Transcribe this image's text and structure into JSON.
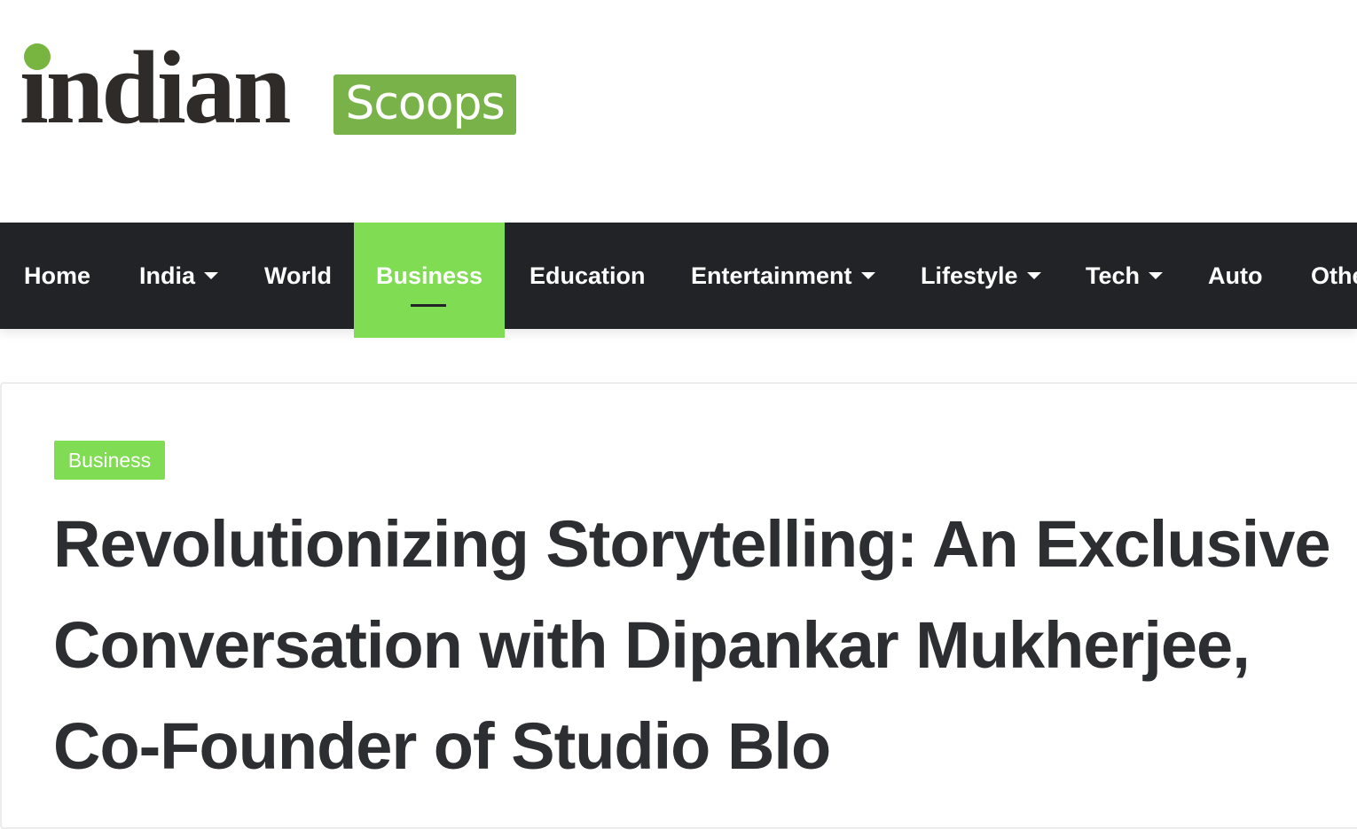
{
  "header": {
    "logo": {
      "word": "indian",
      "box_text": "Scoops",
      "colors": {
        "word": "#2e2b28",
        "accent": "#78b440"
      }
    }
  },
  "nav": {
    "items": [
      {
        "label": "Home",
        "dropdown": false,
        "active": false
      },
      {
        "label": "India",
        "dropdown": true,
        "active": false
      },
      {
        "label": "World",
        "dropdown": false,
        "active": false
      },
      {
        "label": "Business",
        "dropdown": false,
        "active": true
      },
      {
        "label": "Education",
        "dropdown": false,
        "active": false
      },
      {
        "label": "Entertainment",
        "dropdown": true,
        "active": false
      },
      {
        "label": "Lifestyle",
        "dropdown": true,
        "active": false
      },
      {
        "label": "Tech",
        "dropdown": true,
        "active": false
      },
      {
        "label": "Auto",
        "dropdown": false,
        "active": false
      },
      {
        "label": "Othe",
        "dropdown": false,
        "active": false
      }
    ],
    "colors": {
      "background": "#222327",
      "active": "#80dc52",
      "text": "#ffffff"
    }
  },
  "article": {
    "category": "Business",
    "title": "Revolutionizing Storytelling: An Exclusive Conversation with Dipankar Mukherjee, Co-Founder of Studio Blo"
  }
}
